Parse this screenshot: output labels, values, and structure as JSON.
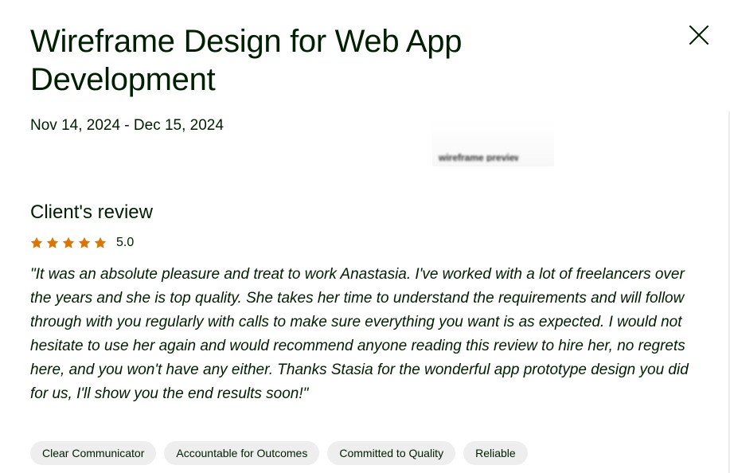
{
  "project": {
    "title": "Wireframe Design for Web App Development",
    "dates": "Nov 14, 2024 - Dec 15, 2024"
  },
  "preview": {
    "icon": "project-thumbnail-image",
    "caption": "wireframe preview"
  },
  "review": {
    "heading": "Client's review",
    "rating": 5.0,
    "rating_label": "5.0",
    "stars": 5,
    "star_color": "#d97706",
    "text": "\"It was an absolute pleasure and treat to work Anastasia. I've worked with a lot of freelancers over the years and she is top quality. She takes her time to understand the requirements and will follow through with you regularly with calls to make sure everything you want is as expected. I would not hesitate to use her again and would recommend anyone reading this review to hire her, no regrets here, and you won't have any either. Thanks Stasia for the wonderful app prototype design you did for us, I'll show you the end results soon!\""
  },
  "tags": [
    "Clear Communicator",
    "Accountable for Outcomes",
    "Committed to Quality",
    "Reliable"
  ],
  "controls": {
    "close_icon": "close-icon"
  },
  "colors": {
    "text": "#001e00",
    "tag_bg": "#eeeeee",
    "star": "#d97706"
  }
}
